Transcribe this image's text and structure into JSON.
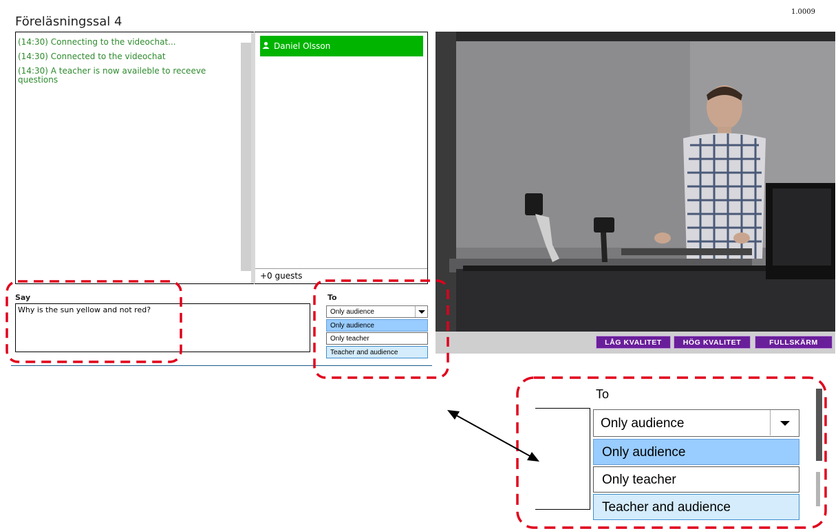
{
  "app": {
    "room_title": "Föreläsningssal 4",
    "version": "1.0009"
  },
  "chat": {
    "messages": [
      "(14:30) Connecting to the videochat...",
      "(14:30) Connected to the videochat",
      "(14:30) A teacher is now availeble to receeve questions"
    ],
    "message_color": "#2e8b2e"
  },
  "users": {
    "list": [
      {
        "name": "Daniel Olsson",
        "icon": "person-icon",
        "highlight": "#00b400"
      }
    ],
    "guests": "+0 guests"
  },
  "compose": {
    "say_label": "Say",
    "say_value": "Why is the sun yellow and not red?",
    "to_label": "To",
    "to_selected": "Only audience",
    "to_options": [
      "Only audience",
      "Only teacher",
      "Teacher and audience"
    ],
    "dropdown_icon": "chevron-down-icon"
  },
  "video": {
    "buttons": {
      "low_quality": "LÅG KVALITET",
      "high_quality": "HÖG KVALITET",
      "fullscreen": "FULLSKÄRM"
    },
    "button_color": "#6a1f9a"
  },
  "annotation": {
    "highlight_color": "#e0001b",
    "zoom": {
      "to_label": "To",
      "selected": "Only audience",
      "options": [
        "Only audience",
        "Only teacher",
        "Teacher and audience"
      ]
    }
  }
}
